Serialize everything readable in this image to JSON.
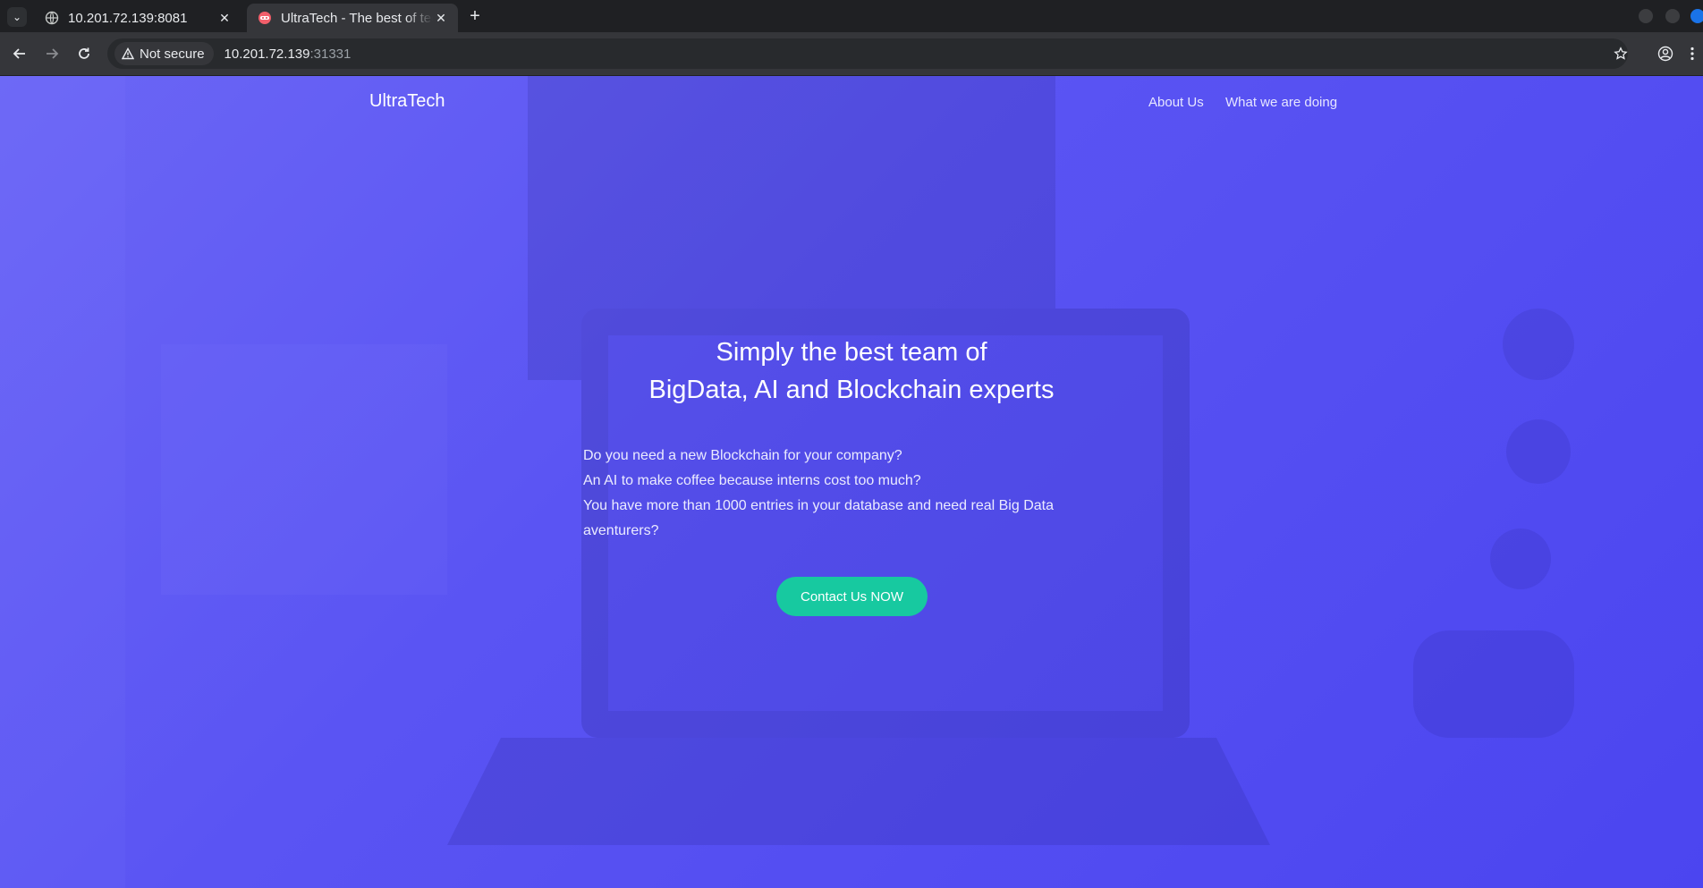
{
  "browser": {
    "tabs": [
      {
        "title": "10.201.72.139:8081",
        "favicon": "globe-icon",
        "active": false
      },
      {
        "title": "UltraTech - The best of technology",
        "favicon": "ultratech-favicon",
        "active": true
      }
    ],
    "security_label": "Not secure",
    "url_host": "10.201.72.139",
    "url_port": ":31331",
    "icons": [
      "tab-search-icon",
      "close-icon",
      "new-tab-icon",
      "back-icon",
      "forward-icon",
      "reload-icon",
      "warning-icon",
      "bookmark-star-icon",
      "profile-icon",
      "kebab-menu-icon"
    ]
  },
  "site": {
    "brand": "UltraTech",
    "nav": [
      {
        "label": "About Us"
      },
      {
        "label": "What we are doing"
      }
    ],
    "hero": {
      "title_line1": "Simply the best team of",
      "title_line2": "BigData, AI and Blockchain experts",
      "lines": [
        "Do you need a new Blockchain for your company?",
        "An AI to make coffee because interns cost too much?",
        "You have more than 1000 entries in your database and need real Big Data",
        "aventurers?"
      ],
      "cta_label": "Contact Us NOW"
    },
    "colors": {
      "background": "#5a54f3",
      "cta": "#17c9a0",
      "text": "#ffffff"
    }
  }
}
